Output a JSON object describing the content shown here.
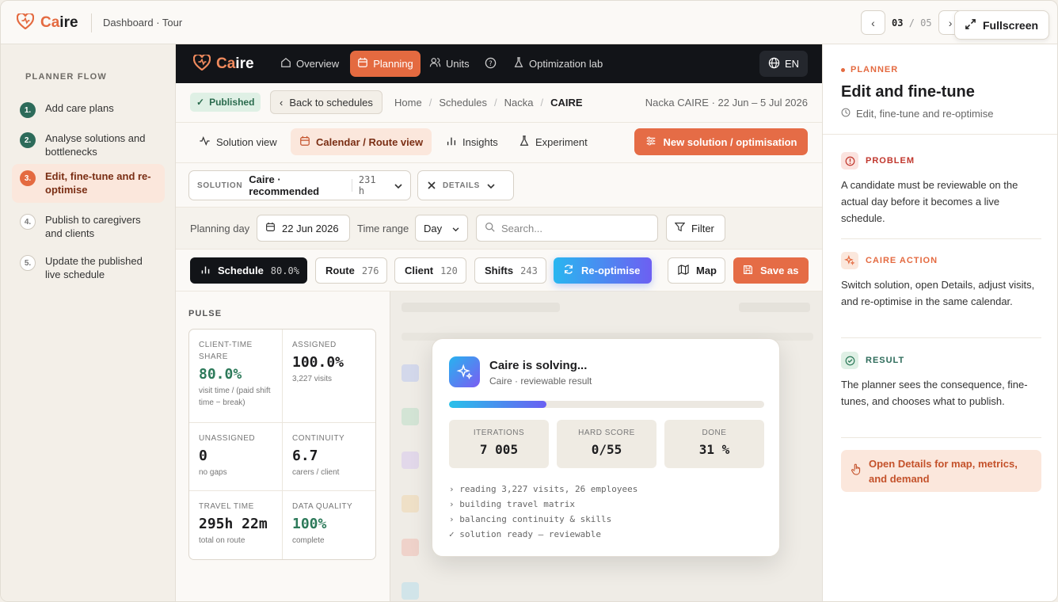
{
  "brand": {
    "name_prefix": "Ca",
    "name_suffix": "ire",
    "accent": "#e46a40"
  },
  "topbar": {
    "crumb": "Dashboard · Tour",
    "page_current": "03",
    "page_sep": "/",
    "page_total": "05",
    "fullscreen_label": "Fullscreen"
  },
  "flow": {
    "title": "PLANNER FLOW",
    "steps": [
      {
        "num": "1.",
        "label": "Add care plans",
        "state": "done"
      },
      {
        "num": "2.",
        "label": "Analyse solutions and bottlenecks",
        "state": "done"
      },
      {
        "num": "3.",
        "label": "Edit, fine-tune and re-optimise",
        "state": "active"
      },
      {
        "num": "4.",
        "label": "Publish to caregivers and clients",
        "state": "todo"
      },
      {
        "num": "5.",
        "label": "Update the published live schedule",
        "state": "todo"
      }
    ]
  },
  "nav": {
    "items": [
      "Overview",
      "Planning",
      "Units",
      "Optimization lab"
    ],
    "lang": "EN"
  },
  "breadcrumb": {
    "status": "Published",
    "back": "Back to schedules",
    "items": [
      "Home",
      "Schedules",
      "Nacka",
      "CAIRE"
    ],
    "range": "Nacka CAIRE · 22 Jun – 5 Jul 2026"
  },
  "tabs": {
    "items": [
      "Solution view",
      "Calendar / Route view",
      "Insights",
      "Experiment"
    ],
    "new_solution": "New solution / optimisation"
  },
  "solution": {
    "label": "SOLUTION",
    "name": "Caire · recommended",
    "hours": "231",
    "unit": "h",
    "details": "DETAILS"
  },
  "filters": {
    "day_label": "Planning day",
    "day_value": "22 Jun 2026",
    "range_label": "Time range",
    "range_value": "Day",
    "search_placeholder": "Search...",
    "filter": "Filter"
  },
  "actions": {
    "schedule": "Schedule",
    "schedule_pct": "80.0%",
    "route": "Route",
    "route_n": "276",
    "client": "Client",
    "client_n": "120",
    "shifts": "Shifts",
    "shifts_n": "243",
    "reoptimise": "Re-optimise",
    "map": "Map",
    "save": "Save as"
  },
  "pulse": {
    "title": "PULSE",
    "cells": [
      {
        "label": "CLIENT-TIME SHARE",
        "value": "80.0%",
        "sub": "visit time / (paid shift time − break)",
        "green": true
      },
      {
        "label": "ASSIGNED",
        "value": "100.0%",
        "sub": "3,227 visits",
        "green": false
      },
      {
        "label": "UNASSIGNED",
        "value": "0",
        "sub": "no gaps",
        "green": false
      },
      {
        "label": "CONTINUITY",
        "value": "6.7",
        "sub": "carers / client",
        "green": false
      },
      {
        "label": "TRAVEL TIME",
        "value": "295h 22m",
        "sub": "total on route",
        "green": false
      },
      {
        "label": "DATA QUALITY",
        "value": "100%",
        "sub": "complete",
        "green": true
      }
    ]
  },
  "modal": {
    "title": "Caire is solving...",
    "subtitle": "Caire · reviewable result",
    "progress": 0.31,
    "stats": [
      {
        "label": "ITERATIONS",
        "value": "7 005"
      },
      {
        "label": "HARD SCORE",
        "value": "0/55"
      },
      {
        "label": "DONE",
        "value": "31 %"
      }
    ],
    "logs": [
      "› reading 3,227 visits, 26 employees",
      "› building travel matrix",
      "› balancing continuity & skills",
      "✓ solution ready — reviewable"
    ]
  },
  "panel": {
    "tag": "PLANNER",
    "title": "Edit and fine-tune",
    "subtitle": "Edit, fine-tune and re-optimise",
    "problem_head": "PROBLEM",
    "problem_body": "A candidate must be reviewable on the actual day before it becomes a live schedule.",
    "action_head": "CAIRE ACTION",
    "action_body": "Switch solution, open Details, adjust visits, and re-optimise in the same calendar.",
    "result_head": "RESULT",
    "result_body": "The planner sees the consequence, fine-tunes, and chooses what to publish.",
    "cta": "Open Details for map, metrics, and demand"
  }
}
